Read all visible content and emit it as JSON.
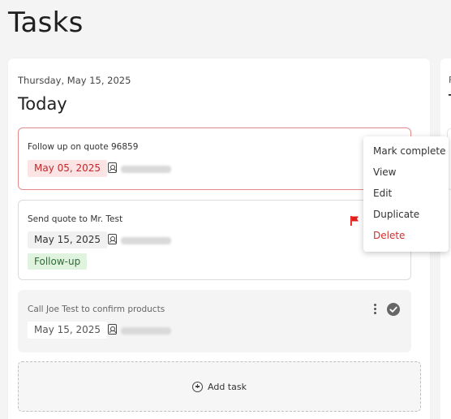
{
  "page": {
    "title": "Tasks"
  },
  "today_column": {
    "date": "Thursday, May 15, 2025",
    "title": "Today"
  },
  "next_column": {
    "date": "F",
    "title": "T"
  },
  "tasks": [
    {
      "title": "Follow up on quote 96859",
      "due": "May 05, 2025",
      "overdue": true,
      "assignee_icon": "assignee-icon"
    },
    {
      "title": "Send quote to Mr. Test",
      "due": "May 15, 2025",
      "flag_icon": "red-flag-icon",
      "tag": "Follow-up",
      "assignee_icon": "assignee-icon"
    },
    {
      "title": "Call Joe Test to confirm products",
      "due": "May 15, 2025",
      "completed": true,
      "assignee_icon": "assignee-icon",
      "more_icon": "more-vertical-icon",
      "status_icon": "check-circle-icon"
    }
  ],
  "add_task": {
    "label": "Add task",
    "icon": "plus-circle-icon"
  },
  "context_menu": {
    "items": [
      {
        "label": "Mark complete"
      },
      {
        "label": "View"
      },
      {
        "label": "Edit"
      },
      {
        "label": "Duplicate"
      },
      {
        "label": "Delete",
        "danger": true
      }
    ]
  },
  "colors": {
    "overdue_border": "#e58a8a",
    "overdue_text": "#c0262a",
    "overdue_bg": "#fde4e4",
    "tag_bg": "#dff3df",
    "tag_text": "#2f6b35",
    "flag": "#e01e1e",
    "delete": "#d22f2f"
  }
}
